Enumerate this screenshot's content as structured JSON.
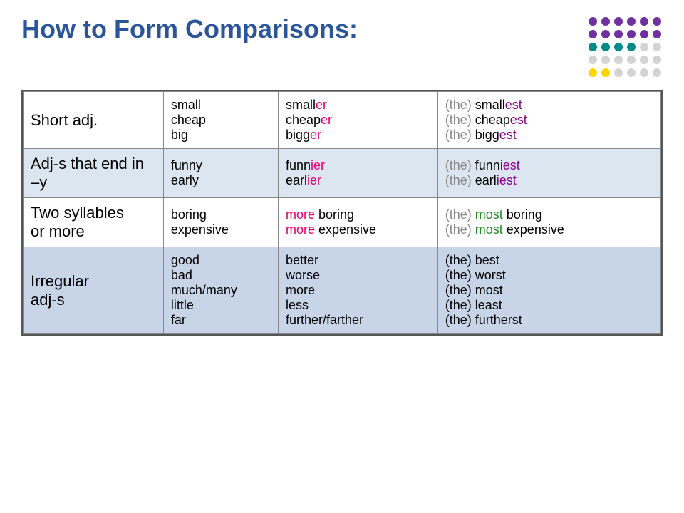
{
  "header": {
    "title": "How to Form Comparisons:"
  },
  "dots": [
    {
      "color": "#7030A0"
    },
    {
      "color": "#7030A0"
    },
    {
      "color": "#7030A0"
    },
    {
      "color": "#7030A0"
    },
    {
      "color": "#7030A0"
    },
    {
      "color": "#7030A0"
    },
    {
      "color": "#7030A0"
    },
    {
      "color": "#7030A0"
    },
    {
      "color": "#7030A0"
    },
    {
      "color": "#7030A0"
    },
    {
      "color": "#7030A0"
    },
    {
      "color": "#7030A0"
    },
    {
      "color": "#008B8B"
    },
    {
      "color": "#008B8B"
    },
    {
      "color": "#008B8B"
    },
    {
      "color": "#008B8B"
    },
    {
      "color": "#D3D3D3"
    },
    {
      "color": "#D3D3D3"
    },
    {
      "color": "#D3D3D3"
    },
    {
      "color": "#D3D3D3"
    },
    {
      "color": "#D3D3D3"
    },
    {
      "color": "#D3D3D3"
    },
    {
      "color": "#D3D3D3"
    },
    {
      "color": "#D3D3D3"
    },
    {
      "color": "#FFD700"
    },
    {
      "color": "#FFD700"
    },
    {
      "color": "#D3D3D3"
    },
    {
      "color": "#D3D3D3"
    },
    {
      "color": "#D3D3D3"
    },
    {
      "color": "#D3D3D3"
    }
  ],
  "rows": [
    {
      "id": "short",
      "category": "Short adj.",
      "base": [
        "small",
        "cheap",
        "big"
      ],
      "comparative_plain": [
        "smaller",
        "cheaper",
        "bigger"
      ],
      "comparative_highlight": [
        "er",
        "er",
        "er"
      ],
      "superlative_prefix": [
        "(the) small",
        "(the) cheap",
        "(the) bigg"
      ],
      "superlative_highlight": [
        "est",
        "est",
        "est"
      ]
    },
    {
      "id": "adjy",
      "category": "Adj-s that end in –y",
      "base": [
        "funny",
        "early"
      ],
      "comparative_plain": [
        "funn",
        "earl"
      ],
      "comparative_highlight": [
        "ier",
        "ier"
      ],
      "superlative_prefix": [
        "(the) funn",
        "(the) earl"
      ],
      "superlative_highlight": [
        "iest",
        "iest"
      ]
    },
    {
      "id": "two",
      "category": "Two syllables or more",
      "base": [
        "boring",
        "expensive"
      ],
      "comparative_more": [
        "more",
        "more"
      ],
      "comparative_plain": [
        " boring",
        " expensive"
      ],
      "superlative_prefix_the": [
        "(the) ",
        "(the) "
      ],
      "superlative_most": [
        "most",
        "most"
      ],
      "superlative_plain": [
        " boring",
        " expensive"
      ]
    },
    {
      "id": "irregular",
      "category": "Irregular adj-s",
      "base": [
        "good",
        "bad",
        "much/many",
        "little",
        "far"
      ],
      "comparative": [
        "better",
        "worse",
        "more",
        "less",
        "further/farther"
      ],
      "superlative": [
        "(the) best",
        "(the) worst",
        "(the) most",
        "(the) least",
        "(the) furtherst"
      ]
    }
  ]
}
